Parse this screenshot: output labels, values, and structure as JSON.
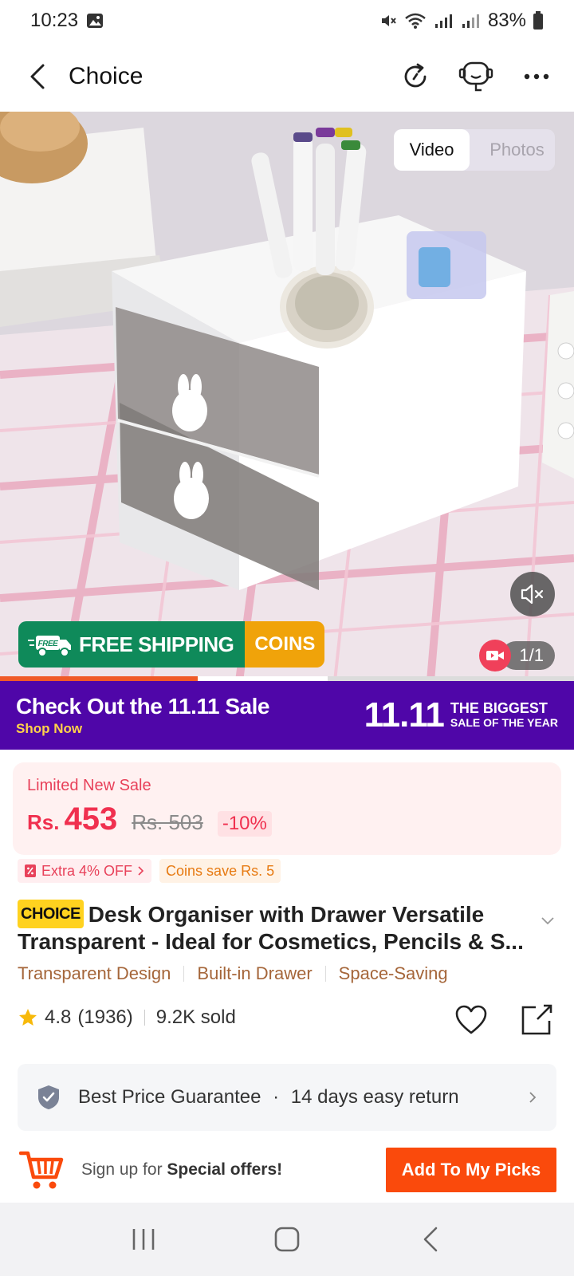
{
  "status_bar": {
    "time": "10:23",
    "battery": "83%"
  },
  "nav": {
    "title": "Choice"
  },
  "media": {
    "tabs": [
      {
        "label": "Video",
        "active": true
      },
      {
        "label": "Photos",
        "active": false
      }
    ],
    "shipping": {
      "free_tag": "FREE",
      "label": "FREE SHIPPING",
      "coins": "COINS"
    },
    "counter": "1/1"
  },
  "sale_banner": {
    "title": "Check Out the 11.11 Sale",
    "cta": "Shop Now",
    "big": "11.11",
    "tag_line1": "THE BIGGEST",
    "tag_line2": "SALE OF THE YEAR"
  },
  "price": {
    "label": "Limited New Sale",
    "currency": "Rs.",
    "amount": "453",
    "old": "Rs. 503",
    "discount": "-10%"
  },
  "coupons": {
    "extra": "Extra 4% OFF",
    "coins": "Coins save Rs. 5"
  },
  "product": {
    "brand": "CHOICE",
    "title": "Desk Organiser with Drawer Versatile Transparent  - Ideal for Cosmetics, Pencils & S..."
  },
  "features": [
    "Transparent Design",
    "Built-in Drawer",
    "Space-Saving"
  ],
  "rating": {
    "score": "4.8",
    "count": "(1936)",
    "sold": "9.2K sold"
  },
  "guarantee": {
    "text1": "Best Price Guarantee",
    "dot": "·",
    "text2": "14 days easy return"
  },
  "bottom": {
    "signup_prefix": "Sign up for ",
    "signup_bold": "Special offers!",
    "button": "Add To My Picks"
  },
  "colors": {
    "accent": "#fa4a0c",
    "price": "#f0304f",
    "banner": "#4f06a8",
    "shipping_green": "#0f8a5a",
    "coins_yellow": "#f0a30a"
  }
}
